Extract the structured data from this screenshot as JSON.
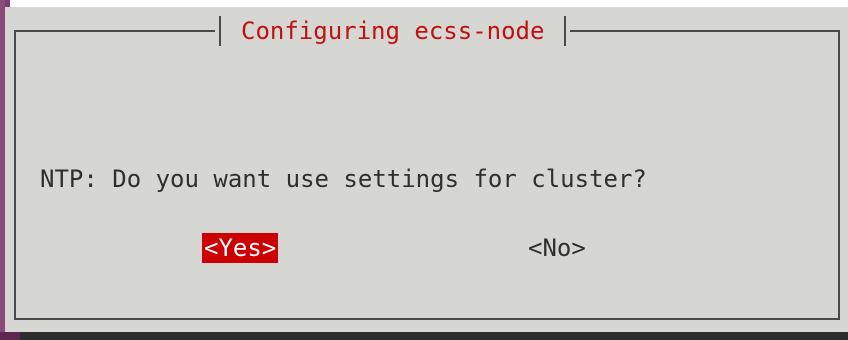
{
  "dialog": {
    "title": "Configuring ecss-node",
    "question": "NTP: Do you want use settings for cluster?",
    "buttons": {
      "yes_label": "<Yes>",
      "no_label": "<No>"
    },
    "selected_button": "yes"
  },
  "colors": {
    "background": "#d6d6d2",
    "title": "#c01010",
    "selected_button_bg": "#cc0000",
    "selected_button_fg": "#ffffff",
    "text": "#2f2f2f",
    "border": "#4a4a4a"
  }
}
